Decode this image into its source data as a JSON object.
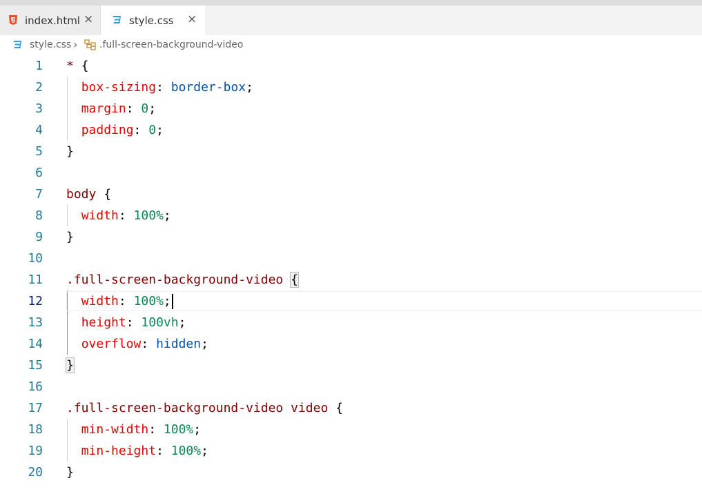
{
  "tabs": [
    {
      "label": "index.html",
      "icon": "html5-icon",
      "active": false,
      "close": "×"
    },
    {
      "label": "style.css",
      "icon": "css3-icon",
      "active": true,
      "close": "×"
    }
  ],
  "breadcrumb": {
    "file": "style.css",
    "separator": "›",
    "symbol": ".full-screen-background-video"
  },
  "editor": {
    "current_line": 12,
    "lines": [
      {
        "n": "1",
        "tokens": [
          [
            "t-selector",
            "*"
          ],
          [
            "t-punct",
            " {"
          ]
        ]
      },
      {
        "n": "2",
        "tokens": [
          [
            "t-punct",
            "  "
          ],
          [
            "t-prop",
            "box-sizing"
          ],
          [
            "t-punct",
            ": "
          ],
          [
            "t-value",
            "border-box"
          ],
          [
            "t-punct",
            ";"
          ]
        ]
      },
      {
        "n": "3",
        "tokens": [
          [
            "t-punct",
            "  "
          ],
          [
            "t-prop",
            "margin"
          ],
          [
            "t-punct",
            ": "
          ],
          [
            "t-num",
            "0"
          ],
          [
            "t-punct",
            ";"
          ]
        ]
      },
      {
        "n": "4",
        "tokens": [
          [
            "t-punct",
            "  "
          ],
          [
            "t-prop",
            "padding"
          ],
          [
            "t-punct",
            ": "
          ],
          [
            "t-num",
            "0"
          ],
          [
            "t-punct",
            ";"
          ]
        ]
      },
      {
        "n": "5",
        "tokens": [
          [
            "t-punct",
            "}"
          ]
        ]
      },
      {
        "n": "6",
        "tokens": []
      },
      {
        "n": "7",
        "tokens": [
          [
            "t-selector",
            "body"
          ],
          [
            "t-punct",
            " {"
          ]
        ]
      },
      {
        "n": "8",
        "tokens": [
          [
            "t-punct",
            "  "
          ],
          [
            "t-prop",
            "width"
          ],
          [
            "t-punct",
            ": "
          ],
          [
            "t-num",
            "100%"
          ],
          [
            "t-punct",
            ";"
          ]
        ]
      },
      {
        "n": "9",
        "tokens": [
          [
            "t-punct",
            "}"
          ]
        ]
      },
      {
        "n": "10",
        "tokens": []
      },
      {
        "n": "11",
        "tokens": [
          [
            "t-selector",
            ".full-screen-background-video"
          ],
          [
            "t-punct",
            " "
          ],
          [
            "bracket-match",
            "{"
          ]
        ]
      },
      {
        "n": "12",
        "tokens": [
          [
            "t-punct",
            "  "
          ],
          [
            "t-prop",
            "width"
          ],
          [
            "t-punct",
            ": "
          ],
          [
            "t-num",
            "100%"
          ],
          [
            "t-punct",
            ";"
          ]
        ]
      },
      {
        "n": "13",
        "tokens": [
          [
            "t-punct",
            "  "
          ],
          [
            "t-prop",
            "height"
          ],
          [
            "t-punct",
            ": "
          ],
          [
            "t-num",
            "100vh"
          ],
          [
            "t-punct",
            ";"
          ]
        ]
      },
      {
        "n": "14",
        "tokens": [
          [
            "t-punct",
            "  "
          ],
          [
            "t-prop",
            "overflow"
          ],
          [
            "t-punct",
            ": "
          ],
          [
            "t-value",
            "hidden"
          ],
          [
            "t-punct",
            ";"
          ]
        ]
      },
      {
        "n": "15",
        "tokens": [
          [
            "bracket-match",
            "}"
          ]
        ]
      },
      {
        "n": "16",
        "tokens": []
      },
      {
        "n": "17",
        "tokens": [
          [
            "t-selector",
            ".full-screen-background-video video"
          ],
          [
            "t-punct",
            " {"
          ]
        ]
      },
      {
        "n": "18",
        "tokens": [
          [
            "t-punct",
            "  "
          ],
          [
            "t-prop",
            "min-width"
          ],
          [
            "t-punct",
            ": "
          ],
          [
            "t-num",
            "100%"
          ],
          [
            "t-punct",
            ";"
          ]
        ]
      },
      {
        "n": "19",
        "tokens": [
          [
            "t-punct",
            "  "
          ],
          [
            "t-prop",
            "min-height"
          ],
          [
            "t-punct",
            ": "
          ],
          [
            "t-num",
            "100%"
          ],
          [
            "t-punct",
            ";"
          ]
        ]
      },
      {
        "n": "20",
        "tokens": [
          [
            "t-punct",
            "}"
          ]
        ]
      }
    ]
  },
  "colors": {
    "selector": "#800000",
    "property": "#e50000",
    "value": "#0451a5",
    "number": "#098658",
    "line_number": "#237893"
  }
}
